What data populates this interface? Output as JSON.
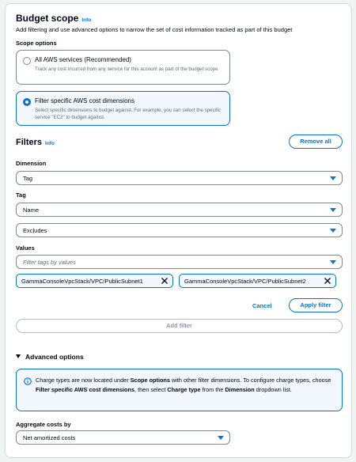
{
  "budget_scope": {
    "title": "Budget scope",
    "info": "Info",
    "description": "Add filtering and use advanced options to narrow the set of cost information tracked as part of this budget"
  },
  "scope_options": {
    "label": "Scope options",
    "options": [
      {
        "title": "All AWS services (Recommended)",
        "description": "Track any cost incurred from any service for this account as part of the budget scope",
        "selected": false
      },
      {
        "title": "Filter specific AWS cost dimensions",
        "description": "Select specific dimensions to budget against. For example, you can select the specific service \"EC2\" to budget against.",
        "selected": true
      }
    ]
  },
  "filters": {
    "title": "Filters",
    "info": "Info",
    "remove_all": "Remove all",
    "dimension_label": "Dimension",
    "dimension_value": "Tag",
    "tag_label": "Tag",
    "tag_value": "Name",
    "operator_value": "Excludes",
    "values_label": "Values",
    "values_placeholder": "Filter tags by values",
    "tokens": [
      "GammaConsoleVpcStack/VPC/PublicSubnet1",
      "GammaConsoleVpcStack/VPC/PublicSubnet2"
    ],
    "cancel": "Cancel",
    "apply": "Apply filter",
    "add_filter": "Add filter"
  },
  "advanced": {
    "title": "Advanced options",
    "info_parts": {
      "p1": "Charge types are now located under ",
      "b1": "Scope options",
      "p2": " with other filter dimensions. To configure charge types, choose ",
      "b2": "Filter specific AWS cost dimensions",
      "p3": ", then select ",
      "b3": "Charge type",
      "p4": " from the ",
      "b4": "Dimension",
      "p5": " dropdown list."
    },
    "aggregate_label": "Aggregate costs by",
    "aggregate_value": "Net amortized costs"
  },
  "colors": {
    "accent": "#0972d3",
    "selected_bg": "#f2f8fd",
    "border": "#7d8998"
  }
}
